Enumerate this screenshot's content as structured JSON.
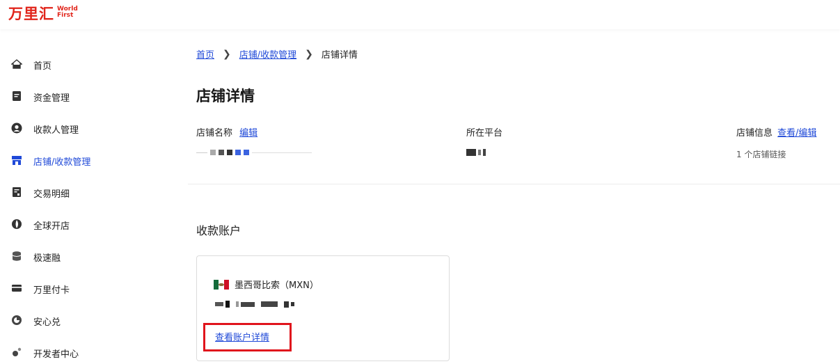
{
  "header": {
    "logo_cn": "万里汇",
    "logo_en": "World First",
    "brand_color": "#e1251b"
  },
  "sidebar": {
    "items": [
      {
        "label": "首页",
        "icon": "home-icon"
      },
      {
        "label": "资金管理",
        "icon": "document-icon"
      },
      {
        "label": "收款人管理",
        "icon": "person-icon"
      },
      {
        "label": "店铺/收款管理",
        "icon": "store-icon",
        "active": true
      },
      {
        "label": "交易明细",
        "icon": "receipt-icon"
      },
      {
        "label": "全球开店",
        "icon": "globe-icon"
      },
      {
        "label": "极速融",
        "icon": "database-icon"
      },
      {
        "label": "万里付卡",
        "icon": "card-icon"
      },
      {
        "label": "安心兑",
        "icon": "exchange-icon"
      },
      {
        "label": "开发者中心",
        "icon": "developer-icon"
      }
    ],
    "active_color": "#1f49d8"
  },
  "breadcrumb": {
    "home": "首页",
    "parent": "店铺/收款管理",
    "current": "店铺详情",
    "separator": "❯"
  },
  "page": {
    "title": "店铺详情"
  },
  "store_info": {
    "name_label": "店铺名称",
    "name_edit": "编辑",
    "platform_label": "所在平台",
    "info_label": "店铺信息",
    "info_link": "查看/编辑",
    "info_sub": "1 个店铺链接"
  },
  "accounts": {
    "section_title": "收款账户",
    "card": {
      "currency_label": "墨西哥比索（MXN）",
      "flag": "mexico-flag-icon",
      "detail_link": "查看账户详情"
    },
    "highlight_color": "#e0141c"
  },
  "link_color": "#1f49d8"
}
